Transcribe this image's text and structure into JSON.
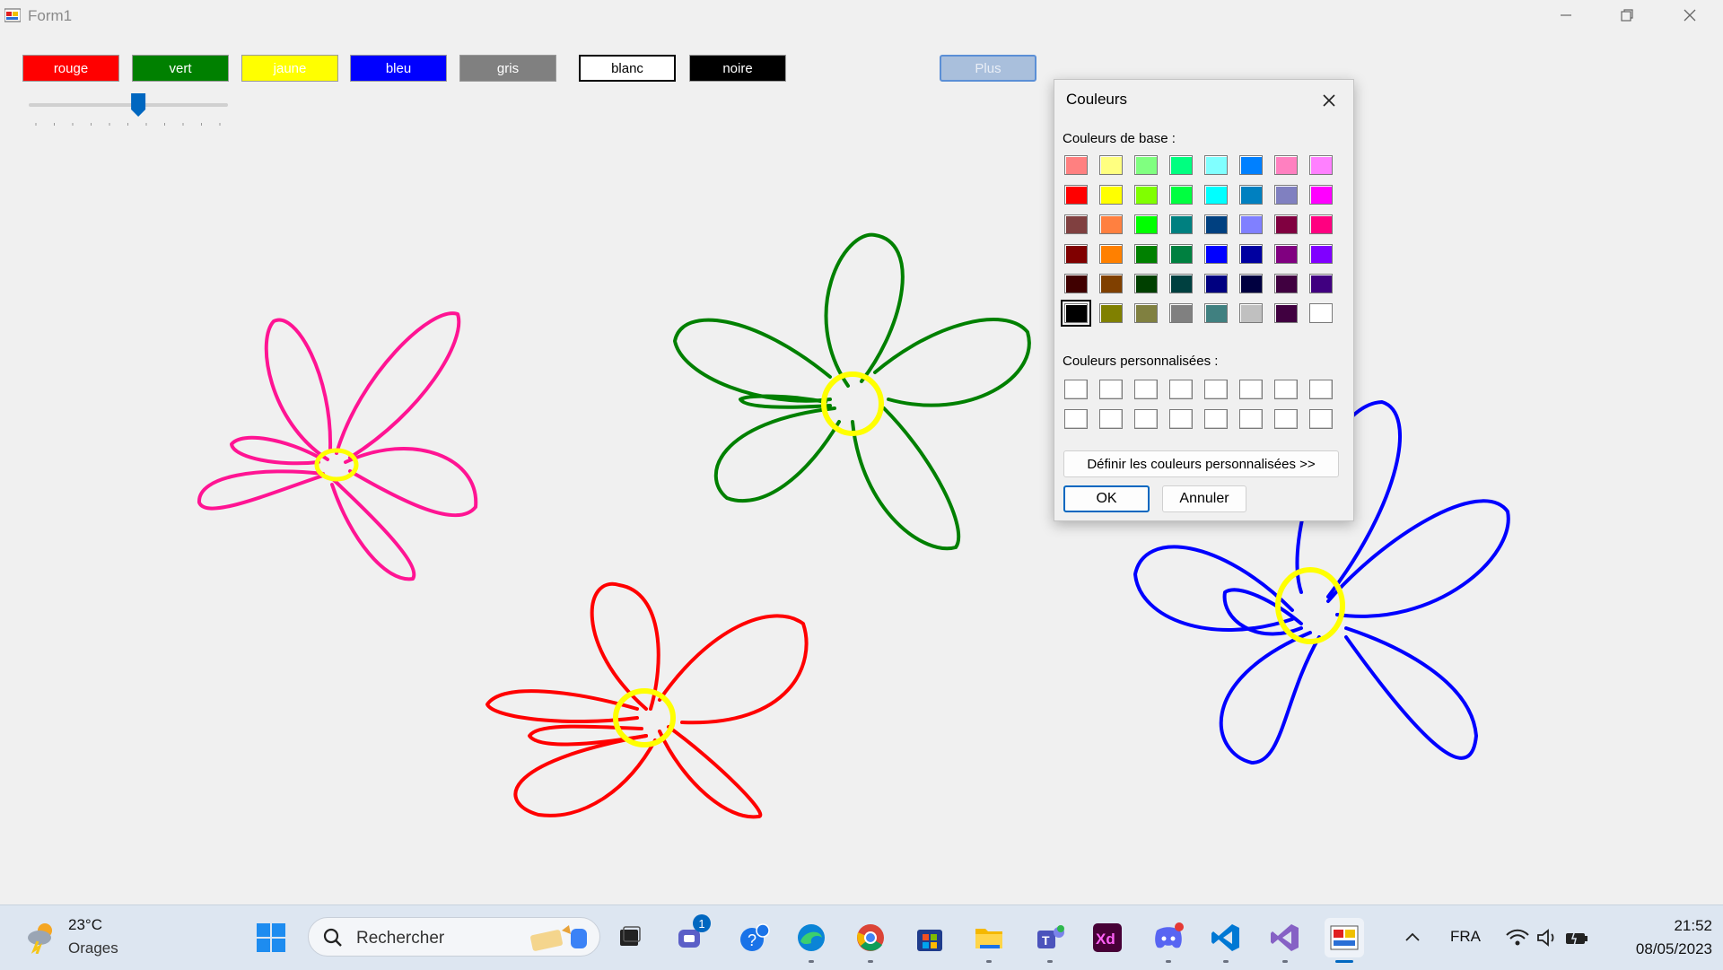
{
  "window": {
    "title": "Form1",
    "minimize_icon": "minimize-icon",
    "restore_icon": "restore-icon",
    "close_icon": "close-icon"
  },
  "toolbar": {
    "colors": [
      {
        "label": "rouge",
        "bg": "#ff0000",
        "fg": "#ffffff"
      },
      {
        "label": "vert",
        "bg": "#008000",
        "fg": "#ffffff"
      },
      {
        "label": "jaune",
        "bg": "#ffff00",
        "fg": "#ffffff"
      },
      {
        "label": "bleu",
        "bg": "#0000ff",
        "fg": "#ffffff"
      },
      {
        "label": "gris",
        "bg": "#808080",
        "fg": "#ffffff"
      },
      {
        "label": "blanc",
        "bg": "#ffffff",
        "fg": "#000000"
      },
      {
        "label": "noire",
        "bg": "#000000",
        "fg": "#ffffff"
      }
    ],
    "more_label": "Plus",
    "slider_value_fraction": 0.55
  },
  "drawing": {
    "flowers": [
      {
        "petal_color": "#ff1493",
        "center_color": "#ffff00"
      },
      {
        "petal_color": "#008000",
        "center_color": "#ffff00"
      },
      {
        "petal_color": "#ff0000",
        "center_color": "#ffff00"
      },
      {
        "petal_color": "#0000ff",
        "center_color": "#ffff00"
      }
    ]
  },
  "color_dialog": {
    "title": "Couleurs",
    "basic_label": "Couleurs de base :",
    "custom_label": "Couleurs personnalisées :",
    "define_label": "Définir les couleurs personnalisées >>",
    "ok_label": "OK",
    "cancel_label": "Annuler",
    "selected_color": "#000000",
    "basic_colors": [
      [
        "#ff8080",
        "#ffff80",
        "#80ff80",
        "#00ff80",
        "#80ffff",
        "#0080ff",
        "#ff80c0",
        "#ff80ff"
      ],
      [
        "#ff0000",
        "#ffff00",
        "#80ff00",
        "#00ff40",
        "#00ffff",
        "#0080c0",
        "#8080c0",
        "#ff00ff"
      ],
      [
        "#804040",
        "#ff8040",
        "#00ff00",
        "#008080",
        "#004080",
        "#8080ff",
        "#800040",
        "#ff0080"
      ],
      [
        "#800000",
        "#ff8000",
        "#008000",
        "#008040",
        "#0000ff",
        "#0000a0",
        "#800080",
        "#8000ff"
      ],
      [
        "#400000",
        "#804000",
        "#004000",
        "#004040",
        "#000080",
        "#000040",
        "#400040",
        "#400080"
      ],
      [
        "#000000",
        "#808000",
        "#808040",
        "#808080",
        "#408080",
        "#c0c0c0",
        "#400040",
        "#ffffff"
      ]
    ],
    "custom_colors_count": 16
  },
  "taskbar": {
    "weather": {
      "temp": "23°C",
      "desc": "Orages",
      "icon": "storm-weather-icon"
    },
    "search_placeholder": "Rechercher",
    "apps": [
      {
        "name": "start-icon"
      },
      {
        "name": "task-view-icon"
      },
      {
        "name": "teams-chat-icon",
        "badge": "1"
      },
      {
        "name": "help-icon"
      },
      {
        "name": "edge-icon"
      },
      {
        "name": "chrome-icon"
      },
      {
        "name": "store-icon"
      },
      {
        "name": "file-explorer-icon"
      },
      {
        "name": "teams-icon"
      },
      {
        "name": "adobe-xd-icon"
      },
      {
        "name": "discord-icon"
      },
      {
        "name": "vscode-icon"
      },
      {
        "name": "visual-studio-icon"
      },
      {
        "name": "form1-app-icon"
      }
    ],
    "language": "FRA",
    "time": "21:52",
    "date": "08/05/2023"
  }
}
